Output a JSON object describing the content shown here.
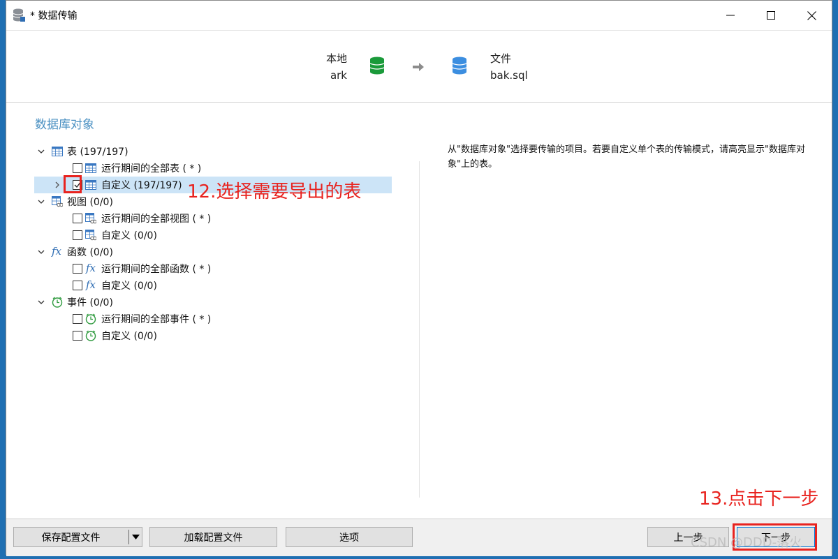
{
  "window": {
    "title": "* 数据传输"
  },
  "header": {
    "source": {
      "type": "本地",
      "name": "ark"
    },
    "target": {
      "type": "文件",
      "name": "bak.sql"
    }
  },
  "section_title": "数据库对象",
  "tree": {
    "tables": {
      "label": "表 (197/197)",
      "runtime_all": "运行期间的全部表 ( * )",
      "custom": "自定义 (197/197)"
    },
    "views": {
      "label": "视图 (0/0)",
      "runtime_all": "运行期间的全部视图 ( * )",
      "custom": "自定义 (0/0)"
    },
    "functions": {
      "label": "函数 (0/0)",
      "runtime_all": "运行期间的全部函数 ( * )",
      "custom": "自定义 (0/0)"
    },
    "events": {
      "label": "事件 (0/0)",
      "runtime_all": "运行期间的全部事件 ( * )",
      "custom": "自定义 (0/0)"
    }
  },
  "description": "从\"数据库对象\"选择要传输的项目。若要自定义单个表的传输模式，请高亮显示\"数据库对象\"上的表。",
  "footer": {
    "save_config": "保存配置文件",
    "load_config": "加载配置文件",
    "options": "选项",
    "prev": "上一步",
    "next": "下一步"
  },
  "annotations": {
    "step12": "12.选择需要导出的表",
    "step13": "13.点击下一步"
  },
  "watermark": "CSDN @DDD-落火",
  "colors": {
    "annotation": "#e8231f",
    "selection": "#cce4f7",
    "section_title": "#4a90c2"
  }
}
